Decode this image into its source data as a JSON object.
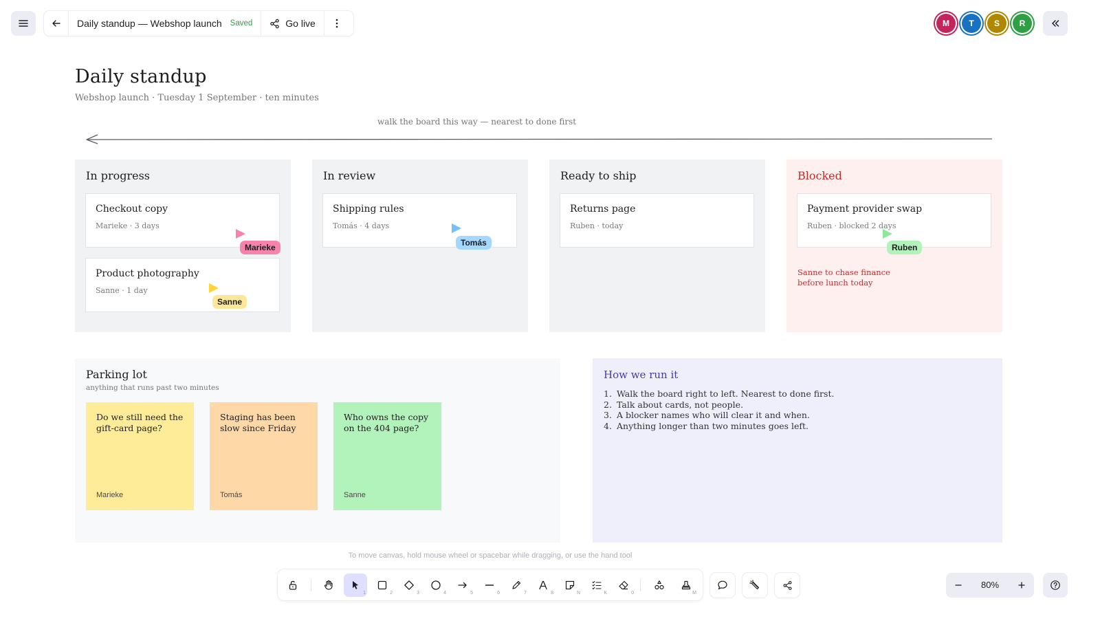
{
  "topbar": {
    "doc_title": "Daily standup — Webshop launch",
    "saved": "Saved",
    "go_live": "Go live",
    "collaborators": [
      {
        "initial": "M",
        "color": "#c2255c"
      },
      {
        "initial": "T",
        "color": "#1971c2"
      },
      {
        "initial": "S",
        "color": "#b08800"
      },
      {
        "initial": "R",
        "color": "#2f9e44"
      }
    ]
  },
  "board": {
    "title": "Daily standup",
    "subtitle": "Webshop launch · Tuesday 1 September · ten minutes",
    "walk_hint": "walk the board this way — nearest to done first"
  },
  "columns": [
    {
      "title": "In progress",
      "cards": [
        {
          "title": "Checkout copy",
          "meta": "Marieke · 3 days"
        },
        {
          "title": "Product photography",
          "meta": "Sanne · 1 day"
        }
      ]
    },
    {
      "title": "In review",
      "cards": [
        {
          "title": "Shipping rules",
          "meta": "Tomás · 4 days"
        }
      ]
    },
    {
      "title": "Ready to ship",
      "cards": [
        {
          "title": "Returns page",
          "meta": "Ruben · today"
        }
      ]
    },
    {
      "title": "Blocked",
      "cards": [
        {
          "title": "Payment provider swap",
          "meta": "Ruben · blocked 2 days"
        }
      ],
      "note": "Sanne to chase finance before lunch today"
    }
  ],
  "cursors": {
    "marieke": {
      "name": "Marieke",
      "color": "#f783ac"
    },
    "sanne": {
      "name": "Sanne",
      "color": "#ffd43b"
    },
    "tomas": {
      "name": "Tomás",
      "color": "#74c0fc"
    },
    "ruben": {
      "name": "Ruben",
      "color": "#8ce99a"
    }
  },
  "parking_lot": {
    "title": "Parking lot",
    "subtitle": "anything that runs past two minutes",
    "stickies": [
      {
        "text": "Do we still need the gift-card page?",
        "author": "Marieke",
        "color": "#ffec99"
      },
      {
        "text": "Staging has been slow since Friday",
        "author": "Tomás",
        "color": "#ffd8a8"
      },
      {
        "text": "Who owns the copy on the 404 page?",
        "author": "Sanne",
        "color": "#b2f2bb"
      }
    ]
  },
  "how_we_run_it": {
    "title": "How we run it",
    "steps": [
      "Walk the board right to left. Nearest to done first.",
      "Talk about cards, not people.",
      "A blocker names who will clear it and when.",
      "Anything longer than two minutes goes left."
    ]
  },
  "footer": {
    "canvas_hint": "To move canvas, hold mouse wheel or spacebar while dragging, or use the hand tool",
    "zoom": "80%",
    "tool_keys": {
      "select": "1",
      "rectangle": "2",
      "diamond": "3",
      "ellipse": "4",
      "arrow": "5",
      "line": "6",
      "draw": "7",
      "text": "8",
      "sticky": "N",
      "checklist": "K",
      "eraser": "0",
      "stamp": "M"
    }
  },
  "colors": {
    "accent": "#6965db",
    "column_bg": "#f1f2f4",
    "blocked_bg": "#ffe9e9",
    "blocked_text": "#c92a2a"
  }
}
